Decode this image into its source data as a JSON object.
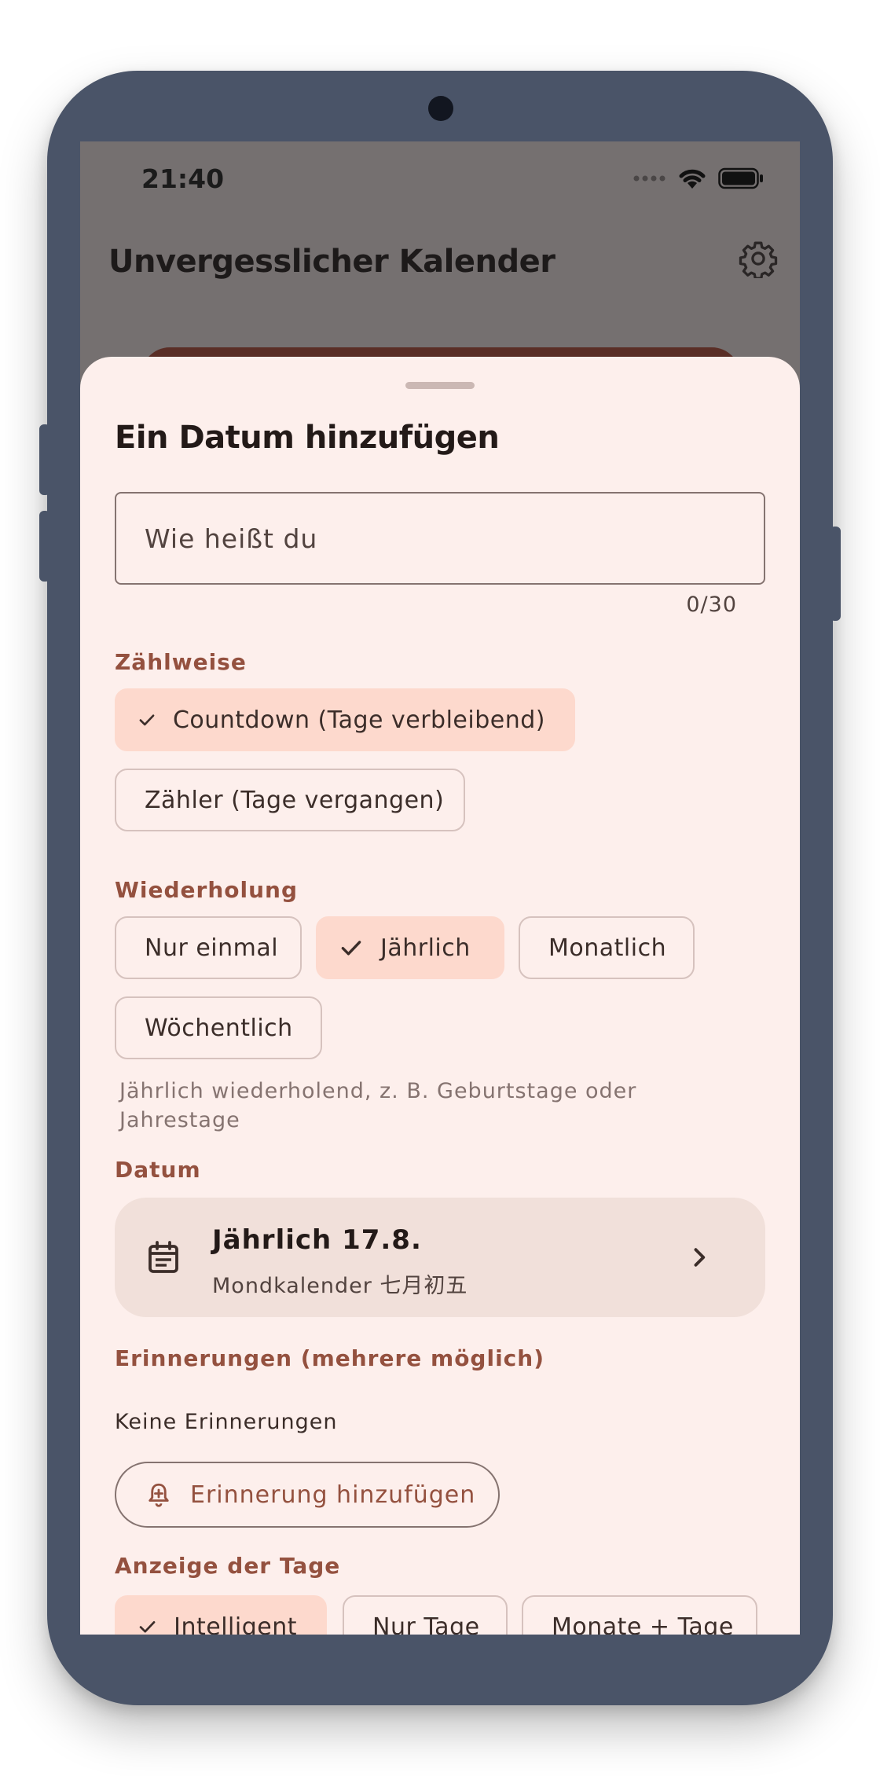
{
  "status": {
    "time": "21:40"
  },
  "app": {
    "title": "Unvergesslicher Kalender"
  },
  "sheet": {
    "title": "Ein Datum hinzufügen",
    "name_placeholder": "Wie heißt du",
    "name_counter": "0/30",
    "counting": {
      "label": "Zählweise",
      "options": [
        "Countdown (Tage verbleibend)",
        "Zähler (Tage vergangen)"
      ],
      "selected": "Countdown (Tage verbleibend)"
    },
    "repeat": {
      "label": "Wiederholung",
      "options": [
        "Nur einmal",
        "Jährlich",
        "Monatlich",
        "Wöchentlich"
      ],
      "selected": "Jährlich",
      "helper": "Jährlich wiederholend, z. B. Geburtstage oder Jahrestage"
    },
    "date": {
      "label": "Datum",
      "main": "Jährlich 17.8.",
      "sub": "Mondkalender 七月初五"
    },
    "reminders": {
      "label": "Erinnerungen (mehrere möglich)",
      "empty": "Keine Erinnerungen",
      "add_label": "Erinnerung hinzufügen"
    },
    "display": {
      "label": "Anzeige der Tage",
      "options": [
        "Intelligent",
        "Nur Tage",
        "Monate + Tage"
      ],
      "selected": "Intelligent"
    }
  },
  "colors": {
    "frame": "#4a5468",
    "sheet": "#fdefec",
    "accent": "#94513f",
    "chip_selected": "#fdd9cd"
  }
}
